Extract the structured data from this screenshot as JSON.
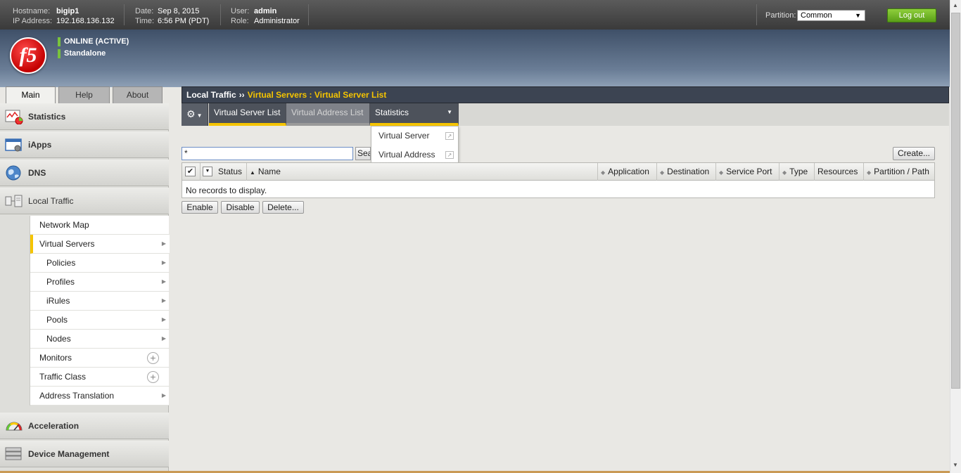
{
  "topbar": {
    "hostname_label": "Hostname:",
    "hostname": "bigip1",
    "ip_label": "IP Address:",
    "ip": "192.168.136.132",
    "date_label": "Date:",
    "date": "Sep 8, 2015",
    "time_label": "Time:",
    "time": "6:56 PM (PDT)",
    "user_label": "User:",
    "user": "admin",
    "role_label": "Role:",
    "role": "Administrator",
    "partition_label": "Partition:",
    "partition_value": "Common",
    "logout_label": "Log out"
  },
  "status": {
    "line1": "ONLINE (ACTIVE)",
    "line2": "Standalone",
    "indicator_color": "#79c23c"
  },
  "logo": {
    "text": "f5",
    "color": "#c40000"
  },
  "tabs": [
    {
      "label": "Main",
      "active": true
    },
    {
      "label": "Help",
      "active": false
    },
    {
      "label": "About",
      "active": false
    }
  ],
  "sidebar": {
    "sections": [
      {
        "label": "Statistics",
        "icon": "statistics-icon"
      },
      {
        "label": "iApps",
        "icon": "iapps-icon"
      },
      {
        "label": "DNS",
        "icon": "globe-icon"
      },
      {
        "label": "Local Traffic",
        "icon": "local-traffic-icon"
      },
      {
        "label": "Acceleration",
        "icon": "gauge-icon"
      },
      {
        "label": "Device Management",
        "icon": "server-icon"
      }
    ],
    "local_traffic_items": [
      {
        "label": "Network Map"
      },
      {
        "label": "Virtual Servers"
      },
      {
        "label": "Policies"
      },
      {
        "label": "Profiles"
      },
      {
        "label": "iRules"
      },
      {
        "label": "Pools"
      },
      {
        "label": "Nodes"
      },
      {
        "label": "Monitors"
      },
      {
        "label": "Traffic Class"
      },
      {
        "label": "Address Translation"
      }
    ]
  },
  "breadcrumb": {
    "section": "Local Traffic",
    "separator": "››",
    "current": "Virtual Servers : Virtual Server List"
  },
  "subtabs": [
    {
      "label": "Virtual Server List"
    },
    {
      "label": "Virtual Address List"
    },
    {
      "label": "Statistics"
    }
  ],
  "statistics_menu": [
    {
      "label": "Virtual Server"
    },
    {
      "label": "Virtual Address"
    }
  ],
  "search": {
    "value": "*",
    "button_label": "Search"
  },
  "create_label": "Create...",
  "table": {
    "columns": [
      "Status",
      "Name",
      "Application",
      "Destination",
      "Service Port",
      "Type",
      "Resources",
      "Partition / Path"
    ],
    "empty_message": "No records to display."
  },
  "actions": {
    "enable": "Enable",
    "disable": "Disable",
    "delete": "Delete..."
  },
  "colors": {
    "accent_yellow": "#f5c400",
    "logout_green": "#5a9f18"
  }
}
